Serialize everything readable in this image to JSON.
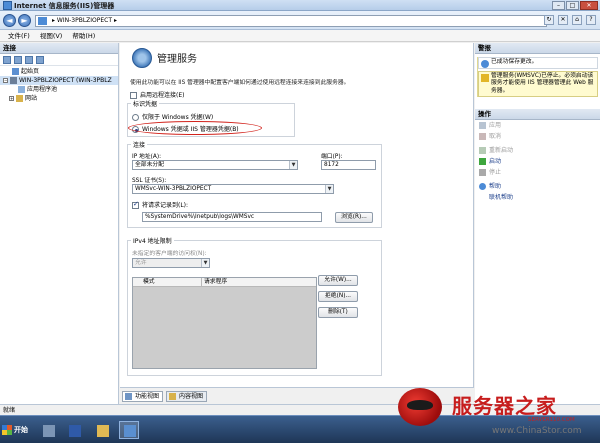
{
  "window": {
    "title": "Internet 信息服务(IIS)管理器",
    "controls": {
      "minimize": "–",
      "maximize": "□",
      "close": "✕"
    }
  },
  "addressbar": {
    "back": "◄",
    "forward": "►",
    "path": "▸ WIN-3PBLZIOPECT ▸"
  },
  "menu": {
    "items": [
      "文件(F)",
      "视图(V)",
      "帮助(H)"
    ]
  },
  "left_pane": {
    "header": "连接",
    "tree": [
      {
        "label": "起始页",
        "indent": 0
      },
      {
        "label": "WIN-3PBLZIOPECT (WIN-3PBLZ",
        "indent": 0
      },
      {
        "label": "应用程序池",
        "indent": 1
      },
      {
        "label": "网站",
        "indent": 1
      }
    ]
  },
  "main": {
    "title": "管理服务",
    "description": "使用此功能可以在 IIS 管理器中配置客户端如何通过使用远程连接来连接到此服务器。",
    "enable_remote": "启用远程连接(E)",
    "identity_group": "标识凭据",
    "radio_windows_only": "仅限于 Windows 凭据(W)",
    "radio_windows_iis": "Windows 凭据或 IIS 管理器凭据(B)",
    "connection_group": "连接",
    "ip_label": "IP 地址(A):",
    "ip_value": "全部未分配",
    "port_label": "端口(P):",
    "port_value": "8172",
    "ssl_label": "SSL 证书(S):",
    "ssl_value": "WMSvc-WIN-3PBLZIOPECT",
    "log_label": "将请求记录到(L):",
    "log_value": "%SystemDrive%\\Inetpub\\logs\\WMSvc",
    "browse_button": "浏览(R)...",
    "ipv4_group": "IPv4 地址限制",
    "unspecified_label": "未指定的客户端的访问权(N):",
    "unspecified_value": "允许",
    "list_columns": [
      "模式",
      "请求程序"
    ],
    "allow_button": "允许(W)...",
    "deny_button": "拒绝(N)...",
    "remove_button": "删除(T)"
  },
  "bottom_tabs": [
    "功能视图",
    "内容视图"
  ],
  "right_pane": {
    "alerts_header": "警报",
    "alerts": [
      {
        "type": "ok",
        "text": "已成功保存更改。"
      },
      {
        "type": "warn",
        "text": "管理服务(WMSVC)已停止。必须启动该服务才能使用 IIS 管理器管理此 Web 服务器。"
      }
    ],
    "actions_header": "操作",
    "actions": [
      {
        "label": "应用",
        "state": "disabled",
        "icon": "apply-icon"
      },
      {
        "label": "取消",
        "state": "disabled",
        "icon": "cancel-icon"
      },
      {
        "label": "重新启动",
        "state": "disabled",
        "icon": "restart-icon"
      },
      {
        "label": "启动",
        "state": "enabled",
        "icon": "start-icon"
      },
      {
        "label": "停止",
        "state": "disabled",
        "icon": "stop-icon"
      },
      {
        "label": "帮助",
        "state": "link",
        "icon": "help-icon"
      },
      {
        "label": "联机帮助",
        "state": "link",
        "icon": ""
      }
    ]
  },
  "status": {
    "text": "就绪"
  },
  "taskbar": {
    "start": "开始"
  },
  "watermark": {
    "title": "服务器之家",
    "url_small": "SERVER110.COM",
    "site": "www.ChinaStor.com"
  },
  "colors": {
    "highlight_oval": "#d2231c",
    "link": "#1c3f8b",
    "alert_warn_bg": "#fffbd0"
  }
}
